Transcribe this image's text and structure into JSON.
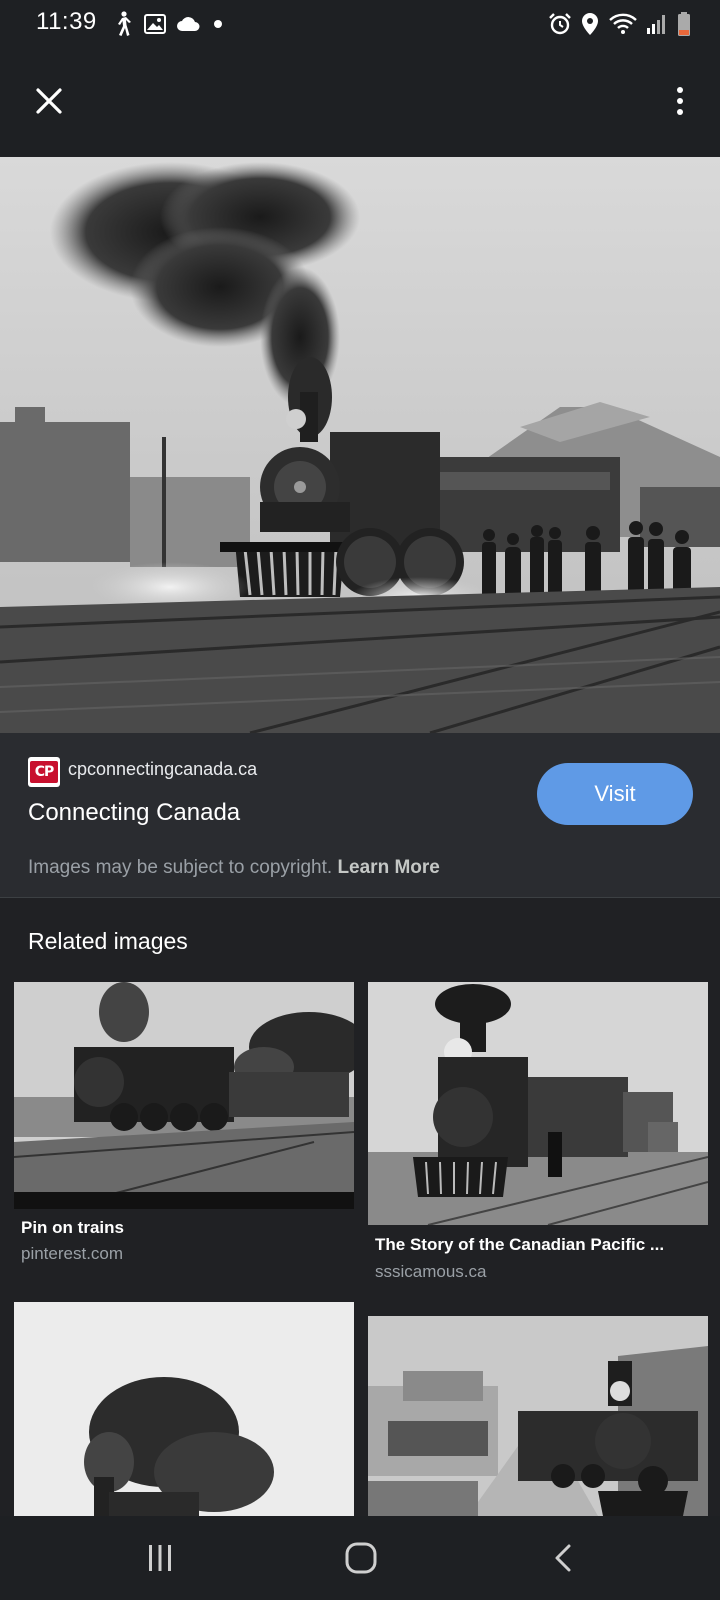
{
  "status_bar": {
    "time": "11:39",
    "left_icons": [
      "walking-icon",
      "image-icon",
      "cloud-icon",
      "dot-icon"
    ],
    "right_icons": [
      "alarm-icon",
      "location-icon",
      "wifi-icon",
      "signal-icon",
      "battery-icon"
    ]
  },
  "toolbar": {
    "close_icon": "close-icon",
    "more_icon": "more-vert-icon"
  },
  "source": {
    "logo_text": "CP",
    "domain": "cpconnectingcanada.ca",
    "title": "Connecting Canada",
    "visit_label": "Visit",
    "copyright_text": "Images may be subject to copyright.",
    "learn_more": "Learn More"
  },
  "related": {
    "heading": "Related images",
    "cards": [
      {
        "title": "Pin on trains",
        "domain": "pinterest.com"
      },
      {
        "title": "The Story of the Canadian Pacific ...",
        "domain": "sssicamous.ca"
      },
      {
        "title": "",
        "domain": ""
      },
      {
        "title": "",
        "domain": ""
      }
    ]
  },
  "nav_bar": {
    "icons": [
      "recent-apps-icon",
      "home-icon",
      "back-icon"
    ]
  },
  "colors": {
    "background": "#202124",
    "panel": "#2a2c30",
    "accent": "#5f9ae6",
    "muted_text": "#9aa0a6"
  }
}
